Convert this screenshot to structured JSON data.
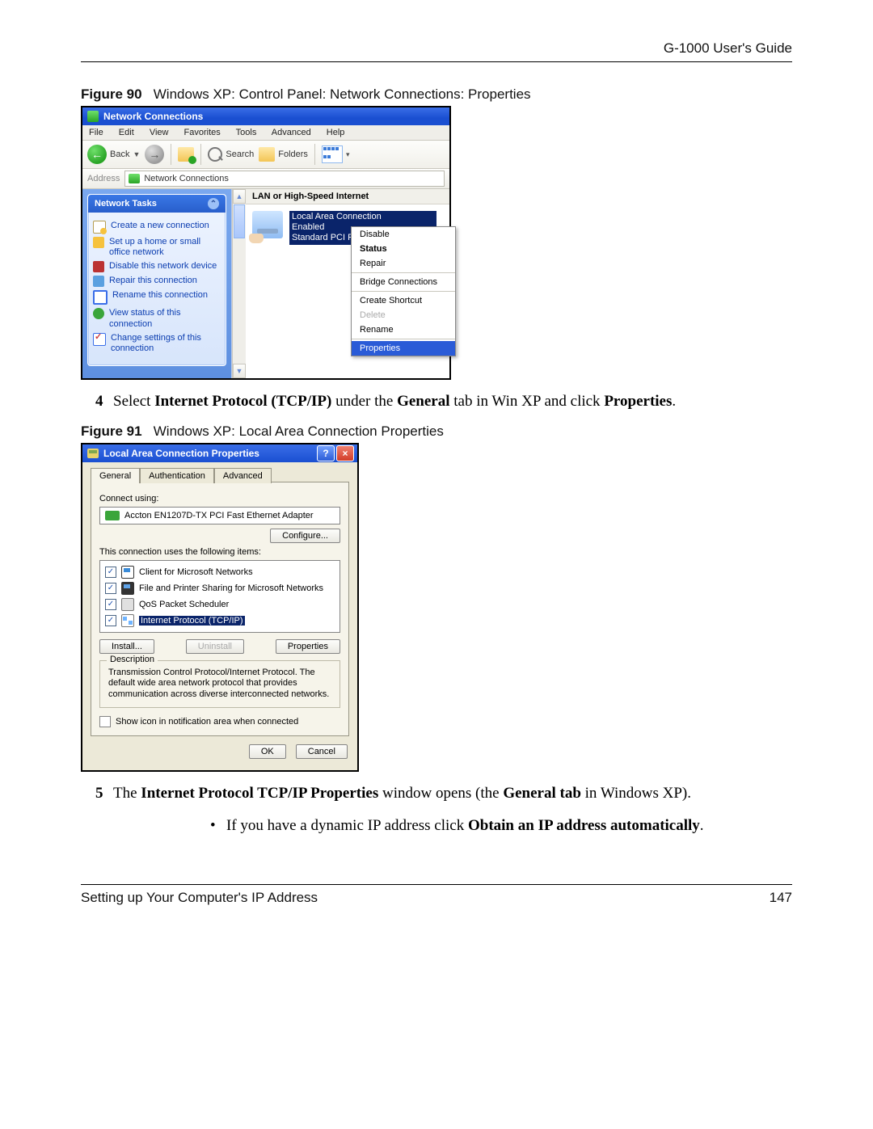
{
  "header": {
    "guide_title": "G-1000 User's Guide"
  },
  "footer": {
    "section": "Setting up Your Computer's IP Address",
    "page": "147"
  },
  "fig90": {
    "caption_prefix": "Figure 90",
    "caption_text": "Windows XP: Control Panel: Network Connections: Properties",
    "titlebar": "Network Connections",
    "menubar": [
      "File",
      "Edit",
      "View",
      "Favorites",
      "Tools",
      "Advanced",
      "Help"
    ],
    "toolbar": {
      "back": "Back",
      "search": "Search",
      "folders": "Folders"
    },
    "addressbar": {
      "label": "Address",
      "value": "Network Connections"
    },
    "side_header": "Network Tasks",
    "side_items": [
      "Create a new connection",
      "Set up a home or small office network",
      "Disable this network device",
      "Repair this connection",
      "Rename this connection",
      "View status of this connection",
      "Change settings of this connection"
    ],
    "section_header": "LAN or High-Speed Internet",
    "connection": {
      "name": "Local Area Connection",
      "status": "Enabled",
      "device": "Standard PCI Fast Ethernet Adapter"
    },
    "context_menu": {
      "disable": "Disable",
      "status": "Status",
      "repair": "Repair",
      "bridge": "Bridge Connections",
      "shortcut": "Create Shortcut",
      "delete": "Delete",
      "rename": "Rename",
      "properties": "Properties"
    }
  },
  "step4": {
    "num": "4",
    "pre": "Select ",
    "bold1": "Internet Protocol (TCP/IP)",
    "mid": " under the ",
    "bold2": "General",
    "post": " tab in Win XP and click ",
    "bold3": "Properties",
    "end": "."
  },
  "fig91": {
    "caption_prefix": "Figure 91",
    "caption_text": "Windows XP: Local Area Connection Properties",
    "title": "Local Area Connection Properties",
    "tabs": [
      "General",
      "Authentication",
      "Advanced"
    ],
    "connect_using_label": "Connect using:",
    "adapter": "Accton EN1207D-TX PCI Fast Ethernet Adapter",
    "configure": "Configure...",
    "uses_label": "This connection uses the following items:",
    "items": [
      "Client for Microsoft Networks",
      "File and Printer Sharing for Microsoft Networks",
      "QoS Packet Scheduler",
      "Internet Protocol (TCP/IP)"
    ],
    "install": "Install...",
    "uninstall": "Uninstall",
    "properties": "Properties",
    "desc_legend": "Description",
    "description": "Transmission Control Protocol/Internet Protocol. The default wide area network protocol that provides communication across diverse interconnected networks.",
    "show_icon": "Show icon in notification area when connected",
    "ok": "OK",
    "cancel": "Cancel"
  },
  "step5": {
    "num": "5",
    "pre": "The ",
    "bold1": "Internet Protocol TCP/IP Properties",
    "mid": " window opens (the ",
    "bold2": "General tab",
    "post": " in Windows XP)."
  },
  "bullet1": {
    "pre": "If you have a dynamic IP address click ",
    "bold": "Obtain an IP address automatically",
    "end": "."
  }
}
